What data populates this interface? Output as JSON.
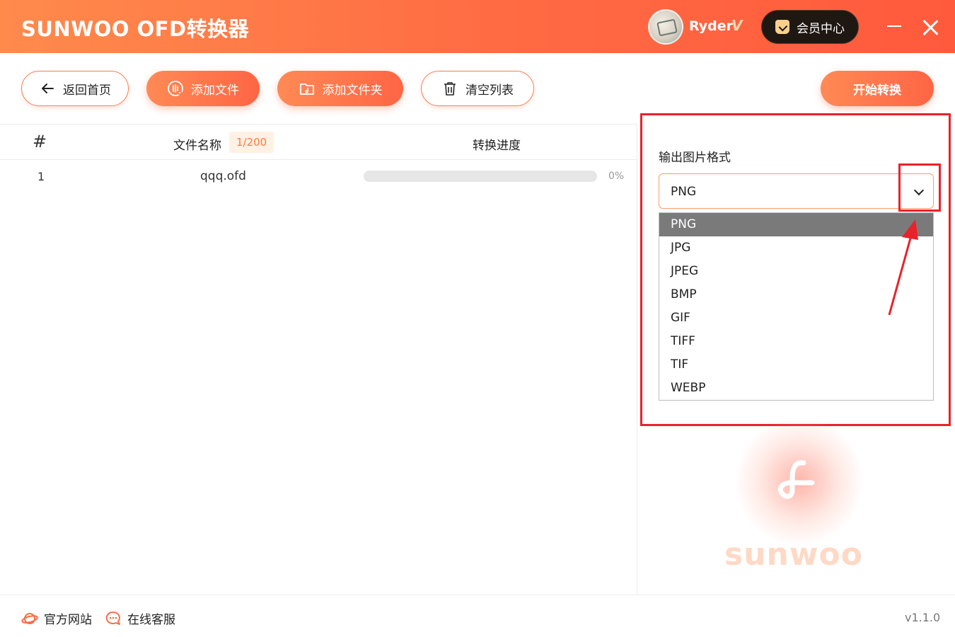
{
  "app": {
    "title": "SUNWOO OFD转换器",
    "username": "Ryder",
    "vip_mark": "V",
    "member_center_label": "会员中心"
  },
  "toolbar": {
    "back_label": "返回首页",
    "add_file_label": "添加文件",
    "add_folder_label": "添加文件夹",
    "clear_label": "清空列表",
    "start_label": "开始转换"
  },
  "file_list": {
    "headers": {
      "index": "#",
      "name": "文件名称",
      "count": "1/200",
      "progress": "转换进度"
    },
    "rows": [
      {
        "index": "1",
        "name": "qqq.ofd",
        "progress_text": "0%",
        "progress_value": 0
      }
    ]
  },
  "settings": {
    "format_label": "输出图片格式",
    "selected_format": "PNG",
    "options": [
      "PNG",
      "JPG",
      "JPEG",
      "BMP",
      "GIF",
      "TIFF",
      "TIF",
      "WEBP"
    ],
    "highlighted_option": "PNG"
  },
  "brand": {
    "wordmark": "sunwoo",
    "accent_color": "#ff6a43",
    "annotation_color": "#e8222b"
  },
  "footer": {
    "official_site_label": "官方网站",
    "online_service_label": "在线客服",
    "version": "v1.1.0"
  }
}
